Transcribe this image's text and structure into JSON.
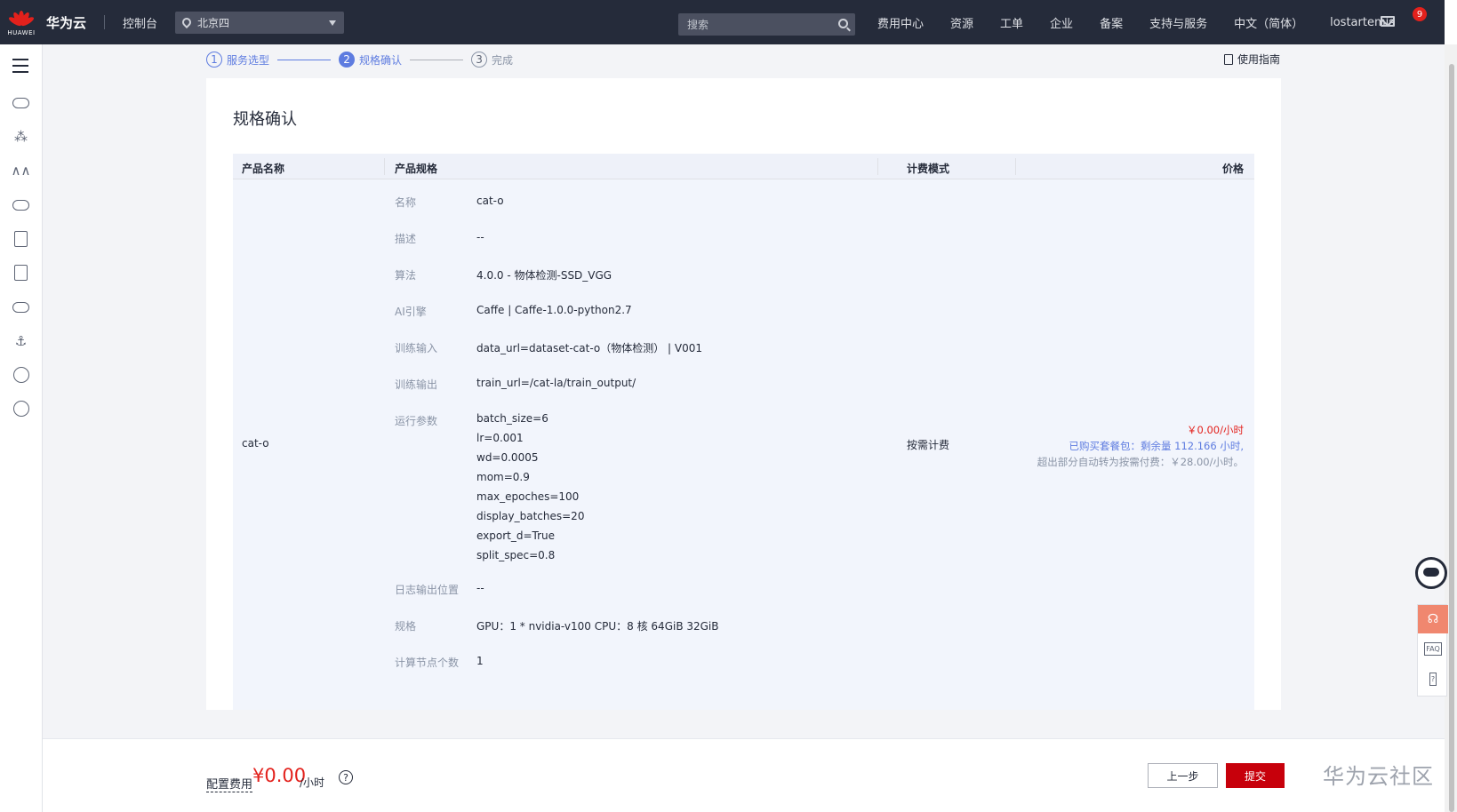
{
  "topbar": {
    "logo_text": "HUAWEI",
    "brand": "华为云",
    "console": "控制台",
    "region": "北京四",
    "search_placeholder": "搜索",
    "nav": [
      "费用中心",
      "资源",
      "工单",
      "企业",
      "备案",
      "支持与服务",
      "中文（简体）",
      "lostartemis"
    ],
    "mail_badge": "9"
  },
  "steps": {
    "items": [
      {
        "num": "1",
        "label": "服务选型"
      },
      {
        "num": "2",
        "label": "规格确认"
      },
      {
        "num": "3",
        "label": "完成"
      }
    ],
    "guide": "使用指南"
  },
  "card": {
    "title": "规格确认",
    "headers": {
      "name": "产品名称",
      "spec": "产品规格",
      "billing": "计费模式",
      "price": "价格"
    },
    "product_name": "cat-o",
    "specs": [
      {
        "key": "名称",
        "value": "cat-o"
      },
      {
        "key": "描述",
        "value": "--"
      },
      {
        "key": "算法",
        "value": "4.0.0 - 物体检测-SSD_VGG"
      },
      {
        "key": "AI引擎",
        "value": "Caffe | Caffe-1.0.0-python2.7"
      },
      {
        "key": "训练输入",
        "value": "data_url=dataset-cat-o（物体检测） | V001"
      },
      {
        "key": "训练输出",
        "value": "train_url=/cat-la/train_output/"
      },
      {
        "key": "运行参数",
        "values": [
          "batch_size=6",
          "lr=0.001",
          "wd=0.0005",
          "mom=0.9",
          "max_epoches=100",
          "display_batches=20",
          "export_d=True",
          "split_spec=0.8"
        ]
      },
      {
        "key": "日志输出位置",
        "value": "--"
      },
      {
        "key": "规格",
        "value": "GPU：1 * nvidia-v100 CPU：8 核 64GiB 32GiB"
      },
      {
        "key": "计算节点个数",
        "value": "1"
      }
    ],
    "billing_mode": "按需计费",
    "price_lines": [
      "￥0.00/小时",
      "已购买套餐包：剩余量 112.166 小时,",
      "超出部分自动转为按需付费：￥28.00/小时。"
    ]
  },
  "bottom": {
    "fee_label": "配置费用",
    "fee_value": "¥0.00",
    "fee_unit": "/小时",
    "help": "?",
    "prev": "上一步",
    "submit": "提交",
    "watermark": "华为云社区"
  },
  "float": {
    "faq": "FAQ"
  },
  "colors": {
    "topbar": "#252b3a",
    "accent": "#5e7ce0",
    "submit": "#c7000b",
    "price": "#e3211c"
  }
}
